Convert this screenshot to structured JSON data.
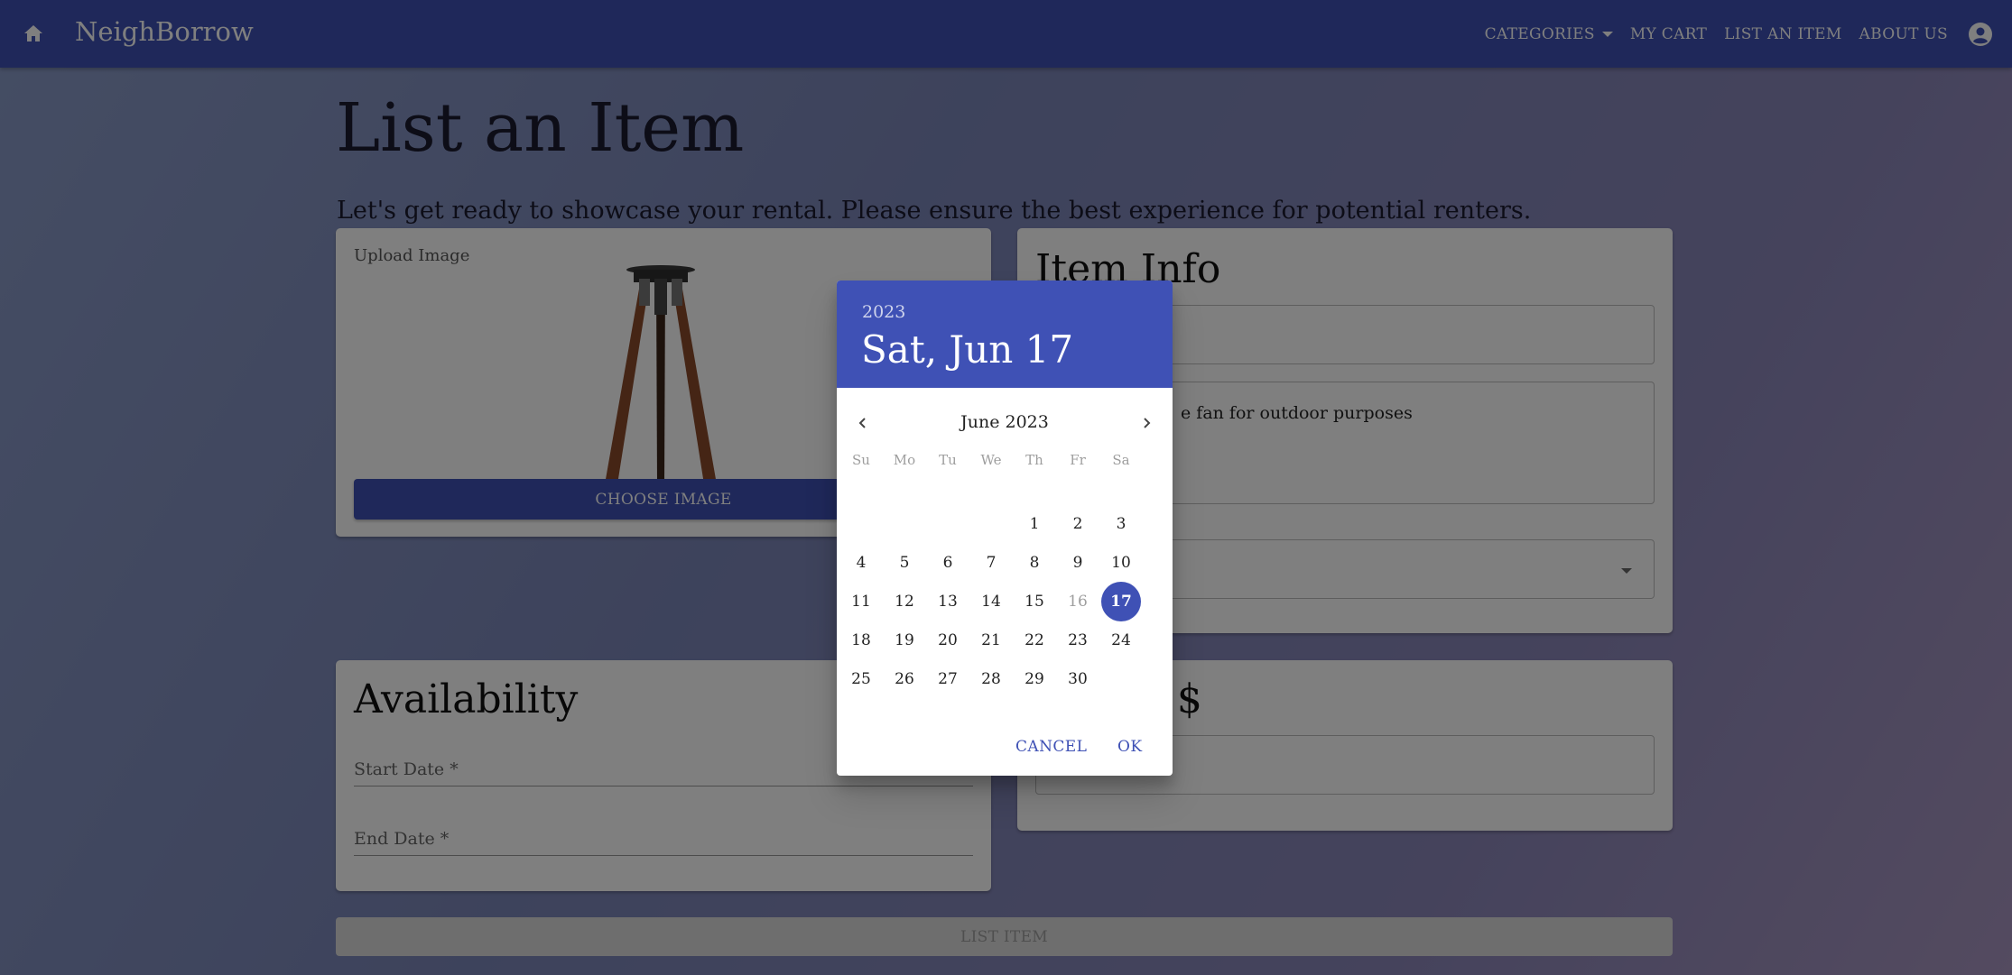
{
  "appbar": {
    "brand": "NeighBorrow",
    "nav": {
      "categories": "CATEGORIES",
      "cart": "MY CART",
      "list_item": "LIST AN ITEM",
      "about": "ABOUT US"
    },
    "color": "#3f51b5"
  },
  "page": {
    "title": "List an Item",
    "subtitle": "Let's get ready to showcase your rental. Please ensure the best experience for potential renters."
  },
  "upload": {
    "label": "Upload Image",
    "button": "CHOOSE IMAGE"
  },
  "item_info": {
    "heading": "Item Info",
    "description_value_visible": "e fan for outdoor purposes"
  },
  "availability": {
    "heading": "Availability",
    "start_label": "Start Date *",
    "end_label": "End Date *"
  },
  "price": {
    "heading_visible": "- $"
  },
  "submit": {
    "label": "LIST ITEM"
  },
  "date_picker": {
    "year": "2023",
    "selected_label": "Sat, Jun 17",
    "month_label": "June 2023",
    "weekdays": [
      "Su",
      "Mo",
      "Tu",
      "We",
      "Th",
      "Fr",
      "Sa"
    ],
    "first_weekday_index": 4,
    "days_in_month": 30,
    "selected_day": 17,
    "muted_day": 16,
    "cancel": "CANCEL",
    "ok": "OK"
  }
}
